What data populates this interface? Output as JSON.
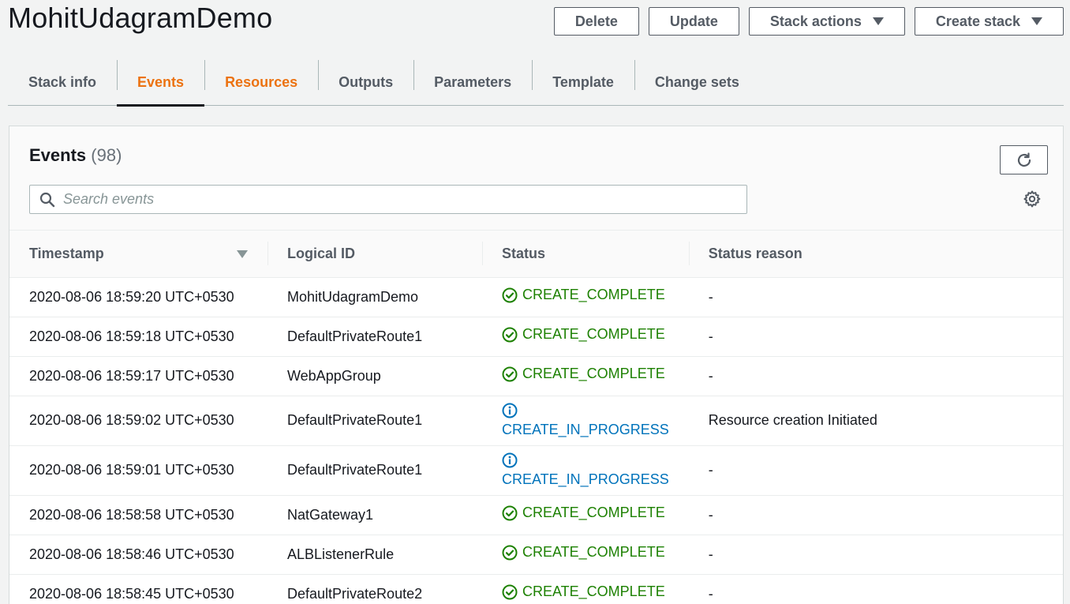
{
  "stack": {
    "name": "MohitUdagramDemo"
  },
  "actions": {
    "delete": "Delete",
    "update": "Update",
    "stack_actions": "Stack actions",
    "create_stack": "Create stack"
  },
  "tabs": [
    {
      "label": "Stack info"
    },
    {
      "label": "Events"
    },
    {
      "label": "Resources"
    },
    {
      "label": "Outputs"
    },
    {
      "label": "Parameters"
    },
    {
      "label": "Template"
    },
    {
      "label": "Change sets"
    }
  ],
  "events": {
    "title": "Events",
    "count": "(98)",
    "search_placeholder": "Search events",
    "columns": {
      "timestamp": "Timestamp",
      "logical_id": "Logical ID",
      "status": "Status",
      "status_reason": "Status reason"
    },
    "rows": [
      {
        "timestamp": "2020-08-06 18:59:20 UTC+0530",
        "logical_id": "MohitUdagramDemo",
        "status": "CREATE_COMPLETE",
        "reason": "-"
      },
      {
        "timestamp": "2020-08-06 18:59:18 UTC+0530",
        "logical_id": "DefaultPrivateRoute1",
        "status": "CREATE_COMPLETE",
        "reason": "-"
      },
      {
        "timestamp": "2020-08-06 18:59:17 UTC+0530",
        "logical_id": "WebAppGroup",
        "status": "CREATE_COMPLETE",
        "reason": "-"
      },
      {
        "timestamp": "2020-08-06 18:59:02 UTC+0530",
        "logical_id": "DefaultPrivateRoute1",
        "status": "CREATE_IN_PROGRESS",
        "reason": "Resource creation Initiated"
      },
      {
        "timestamp": "2020-08-06 18:59:01 UTC+0530",
        "logical_id": "DefaultPrivateRoute1",
        "status": "CREATE_IN_PROGRESS",
        "reason": "-"
      },
      {
        "timestamp": "2020-08-06 18:58:58 UTC+0530",
        "logical_id": "NatGateway1",
        "status": "CREATE_COMPLETE",
        "reason": "-"
      },
      {
        "timestamp": "2020-08-06 18:58:46 UTC+0530",
        "logical_id": "ALBListenerRule",
        "status": "CREATE_COMPLETE",
        "reason": "-"
      },
      {
        "timestamp": "2020-08-06 18:58:45 UTC+0530",
        "logical_id": "DefaultPrivateRoute2",
        "status": "CREATE_COMPLETE",
        "reason": "-"
      }
    ]
  },
  "colors": {
    "complete": "#1d8102",
    "in_progress": "#0073bb",
    "accent": "#ec7211"
  },
  "icons": {
    "complete": "check-circle-icon",
    "in_progress": "info-circle-icon",
    "refresh": "refresh-icon",
    "settings": "gear-icon",
    "search": "search-icon"
  }
}
